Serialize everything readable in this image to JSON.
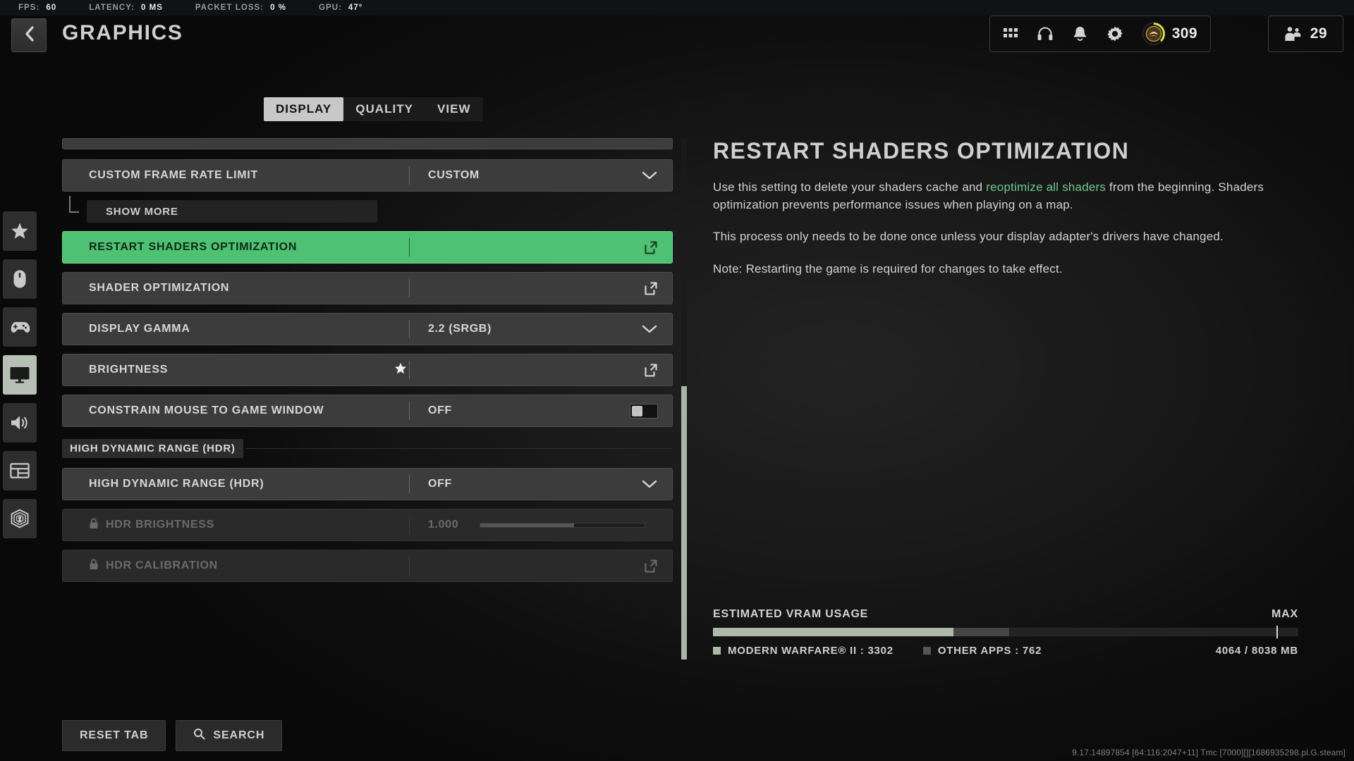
{
  "perf": {
    "items": [
      {
        "label": "FPS:",
        "value": "60"
      },
      {
        "label": "LATENCY:",
        "value": "0 MS"
      },
      {
        "label": "PACKET LOSS:",
        "value": "0 %"
      },
      {
        "label": "GPU:",
        "value": "47°"
      }
    ]
  },
  "header": {
    "title": "GRAPHICS",
    "back_icon": "chevron-left-icon",
    "tools": [
      {
        "icon": "grid-apps-icon"
      },
      {
        "icon": "headphones-icon"
      },
      {
        "icon": "bell-icon"
      },
      {
        "icon": "gear-icon"
      }
    ],
    "rank": {
      "icon": "rank-badge-icon",
      "value": "309"
    },
    "players": {
      "icon": "players-icon",
      "value": "29"
    }
  },
  "rail": {
    "items": [
      {
        "icon": "star-icon",
        "name": "favorites",
        "active": false
      },
      {
        "icon": "mouse-icon",
        "name": "mouse-keyboard",
        "active": false
      },
      {
        "icon": "gamepad-icon",
        "name": "controller",
        "active": false
      },
      {
        "icon": "monitor-icon",
        "name": "graphics",
        "active": true
      },
      {
        "icon": "speaker-icon",
        "name": "audio",
        "active": false
      },
      {
        "icon": "layout-icon",
        "name": "interface",
        "active": false
      },
      {
        "icon": "accessibility-icon",
        "name": "accessibility",
        "active": false
      }
    ]
  },
  "tabs": [
    {
      "label": "DISPLAY",
      "active": true
    },
    {
      "label": "QUALITY",
      "active": false
    },
    {
      "label": "VIEW",
      "active": false
    }
  ],
  "settings": {
    "rows": [
      {
        "type": "partial"
      },
      {
        "type": "row",
        "label": "CUSTOM FRAME RATE LIMIT",
        "value": "CUSTOM",
        "control": "dropdown"
      },
      {
        "type": "subrow",
        "label": "SHOW MORE"
      },
      {
        "type": "row",
        "label": "RESTART SHADERS OPTIMIZATION",
        "value": "",
        "control": "external",
        "selected": true
      },
      {
        "type": "row",
        "label": "SHADER OPTIMIZATION",
        "value": "",
        "control": "external"
      },
      {
        "type": "row",
        "label": "DISPLAY GAMMA",
        "value": "2.2 (SRGB)",
        "control": "dropdown"
      },
      {
        "type": "row",
        "label": "BRIGHTNESS",
        "value": "",
        "control": "external",
        "starred": true
      },
      {
        "type": "row",
        "label": "CONSTRAIN MOUSE TO GAME WINDOW",
        "value": "OFF",
        "control": "toggle",
        "toggle_on": false
      },
      {
        "type": "section",
        "label": "HIGH DYNAMIC RANGE (HDR)"
      },
      {
        "type": "row",
        "label": "HIGH DYNAMIC RANGE (HDR)",
        "value": "OFF",
        "control": "dropdown"
      },
      {
        "type": "row",
        "label": "HDR BRIGHTNESS",
        "value": "1.000",
        "control": "slider",
        "slider_pct": 57,
        "disabled": true,
        "locked": true
      },
      {
        "type": "row",
        "label": "HDR CALIBRATION",
        "value": "",
        "control": "external",
        "disabled": true,
        "locked": true
      }
    ]
  },
  "detail": {
    "title": "RESTART SHADERS OPTIMIZATION",
    "para1_pre": "Use this setting to delete your shaders cache and ",
    "para1_hl": "reoptimize all shaders",
    "para1_post": " from the beginning. Shaders optimization prevents performance issues when playing on a map.",
    "para2": "This process only needs to be done once unless your display adapter's drivers have changed.",
    "para3": "Note: Restarting the game is required for changes to take effect."
  },
  "vram": {
    "title": "ESTIMATED VRAM USAGE",
    "max_label": "MAX",
    "game_label": "MODERN WARFARE® II : 3302",
    "other_label": "OTHER APPS : 762",
    "total_label": "4064 / 8038 MB",
    "game_mb": 3302,
    "other_mb": 762,
    "total_mb": 4064,
    "capacity_mb": 8038,
    "game_color": "#aebaa9",
    "other_color": "#464646"
  },
  "bottom": {
    "reset_label": "RESET TAB",
    "search_label": "SEARCH",
    "search_icon": "search-icon",
    "build": "9.17.14897854 [64:116:2047+11] Tmc [7000][][1686935298.pl.G.steam]"
  }
}
